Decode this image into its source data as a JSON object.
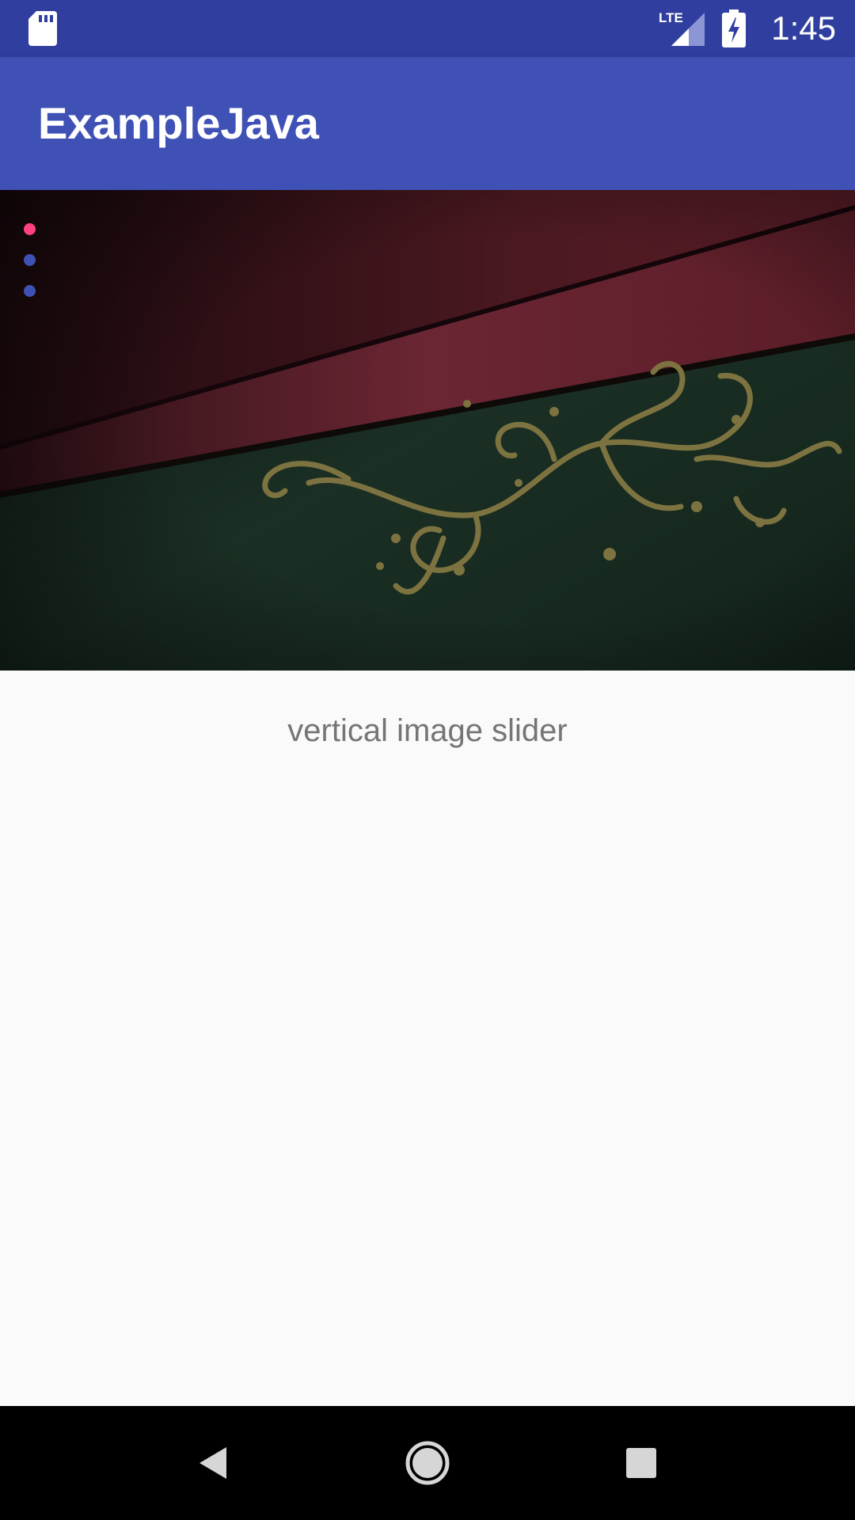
{
  "status_bar": {
    "time": "1:45",
    "network_label": "LTE",
    "icons": [
      "sd-card-icon",
      "lte-signal-icon",
      "battery-charging-icon"
    ],
    "background_color": "#303f9f"
  },
  "app_bar": {
    "title": "ExampleJava",
    "background_color": "#3f51b5"
  },
  "slider": {
    "slide_count": 3,
    "active_index": 0,
    "indicator_active_color": "#ff4081",
    "indicator_inactive_color": "#3f51b5"
  },
  "content": {
    "caption": "vertical image slider"
  },
  "nav_bar": {
    "buttons": [
      "back-icon",
      "home-icon",
      "recents-icon"
    ]
  }
}
